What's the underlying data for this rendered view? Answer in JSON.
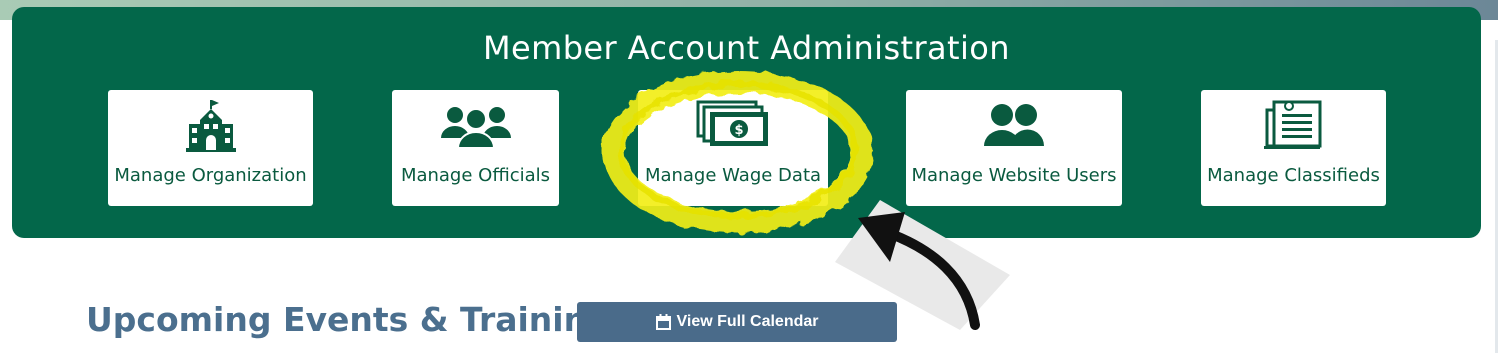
{
  "panel": {
    "title": "Member Account Administration",
    "cards": [
      {
        "label": "Manage Organization",
        "icon": "building-icon"
      },
      {
        "label": "Manage Officials",
        "icon": "group-icon"
      },
      {
        "label": "Manage Wage Data",
        "icon": "money-icon",
        "highlighted": true
      },
      {
        "label": "Manage Website Users",
        "icon": "users-icon"
      },
      {
        "label": "Manage Classifieds",
        "icon": "newspaper-icon"
      }
    ]
  },
  "events": {
    "title": "Upcoming Events & Training",
    "calendar_button": "View Full Calendar",
    "calendar_icon": "calendar-icon"
  },
  "colors": {
    "panel_green": "#03674a",
    "icon_green": "#0a5a3f",
    "highlight_yellow": "#f2ee1a",
    "heading_blue": "#4b6f8e",
    "button_blue": "#4a6b8a"
  }
}
